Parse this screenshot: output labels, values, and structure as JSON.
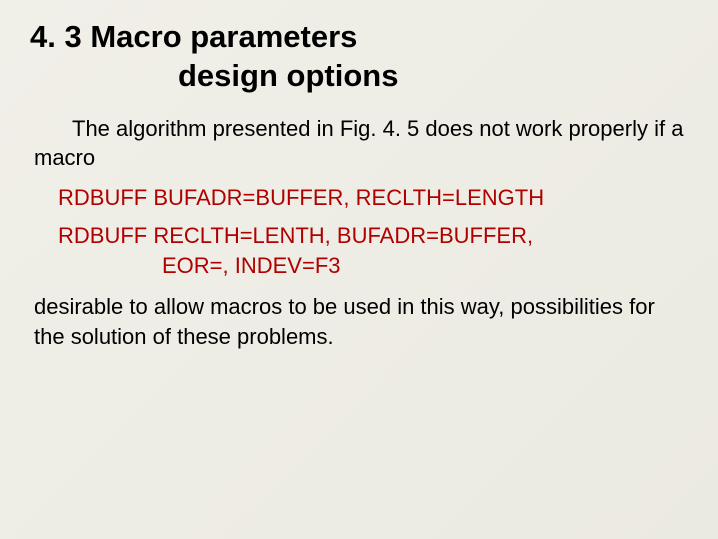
{
  "heading": {
    "line1": "4. 3 Macro parameters",
    "line2": "design options"
  },
  "para1": "The algorithm presented in Fig. 4. 5 does not work properly if a macro",
  "code1": "RDBUFF BUFADR=BUFFER, RECLTH=LENGTH",
  "code2": {
    "line1": "RDBUFF RECLTH=LENTH, BUFADR=BUFFER,",
    "line2": "EOR=, INDEV=F3"
  },
  "para2": "desirable to allow macros to be used in this way, possibilities for the solution of these problems."
}
